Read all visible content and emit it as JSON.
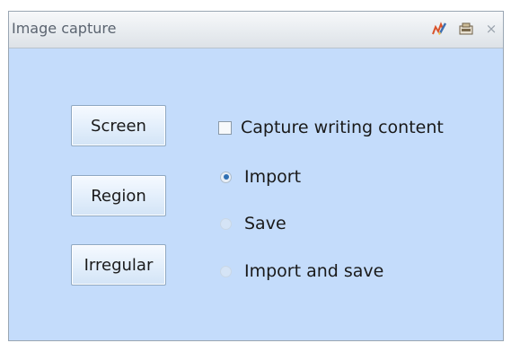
{
  "window": {
    "title": "Image capture"
  },
  "titlebar_icons": [
    "pen-icon",
    "pin-icon",
    "close-icon"
  ],
  "buttons": {
    "screen": "Screen",
    "region": "Region",
    "irregular": "Irregular"
  },
  "options": {
    "capture_writing": {
      "label": "Capture writing content",
      "checked": false
    },
    "import": {
      "label": "Import",
      "selected": true
    },
    "save": {
      "label": "Save",
      "selected": false
    },
    "import_and_save": {
      "label": "Import and save",
      "selected": false
    }
  },
  "colors": {
    "panel_background": "#c4dcfb",
    "radio_selected": "#2f6fb3"
  }
}
